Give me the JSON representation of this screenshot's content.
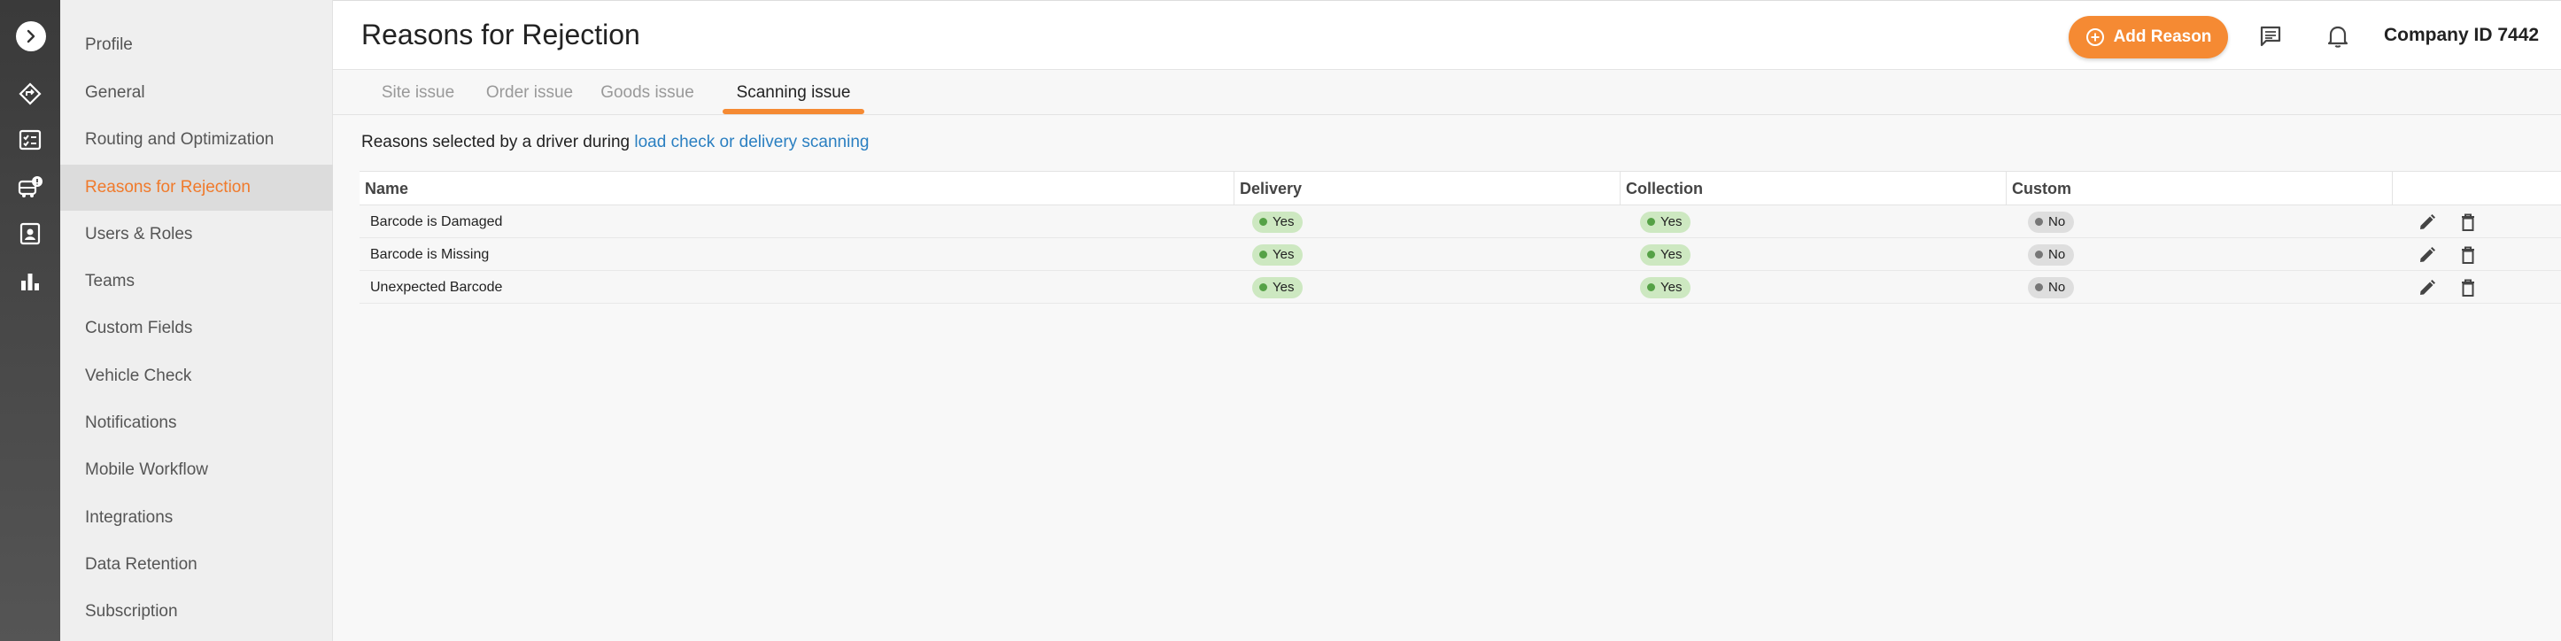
{
  "colors": {
    "accent": "#f58a33",
    "active_text": "#f07a2b",
    "link": "#2a7fc1",
    "yes_bg": "#cde8c1",
    "no_bg": "#dedede"
  },
  "rail": {
    "icons": [
      "chevron-right-icon",
      "route-icon",
      "checklist-icon",
      "vehicle-alert-icon",
      "contacts-icon",
      "bar-chart-icon"
    ]
  },
  "sidebar": {
    "items": [
      {
        "label": "Profile"
      },
      {
        "label": "General"
      },
      {
        "label": "Routing and Optimization"
      },
      {
        "label": "Reasons for Rejection"
      },
      {
        "label": "Users & Roles"
      },
      {
        "label": "Teams"
      },
      {
        "label": "Custom Fields"
      },
      {
        "label": "Vehicle Check"
      },
      {
        "label": "Notifications"
      },
      {
        "label": "Mobile Workflow"
      },
      {
        "label": "Integrations"
      },
      {
        "label": "Data Retention"
      },
      {
        "label": "Subscription"
      }
    ],
    "active": "Reasons for Rejection"
  },
  "header": {
    "title": "Reasons for Rejection",
    "add_label": "Add Reason",
    "company": "Company ID 7442"
  },
  "tabs": [
    {
      "label": "Site issue"
    },
    {
      "label": "Order issue"
    },
    {
      "label": "Goods issue"
    },
    {
      "label": "Scanning issue"
    }
  ],
  "active_tab": "Scanning issue",
  "description": {
    "text": "Reasons selected by a driver during ",
    "link": "load check or delivery scanning"
  },
  "table": {
    "columns": [
      "Name",
      "Delivery",
      "Collection",
      "Custom"
    ],
    "rows": [
      {
        "name": "Barcode is Damaged",
        "delivery": "Yes",
        "collection": "Yes",
        "custom": "No"
      },
      {
        "name": "Barcode is Missing",
        "delivery": "Yes",
        "collection": "Yes",
        "custom": "No"
      },
      {
        "name": "Unexpected Barcode",
        "delivery": "Yes",
        "collection": "Yes",
        "custom": "No"
      }
    ]
  }
}
